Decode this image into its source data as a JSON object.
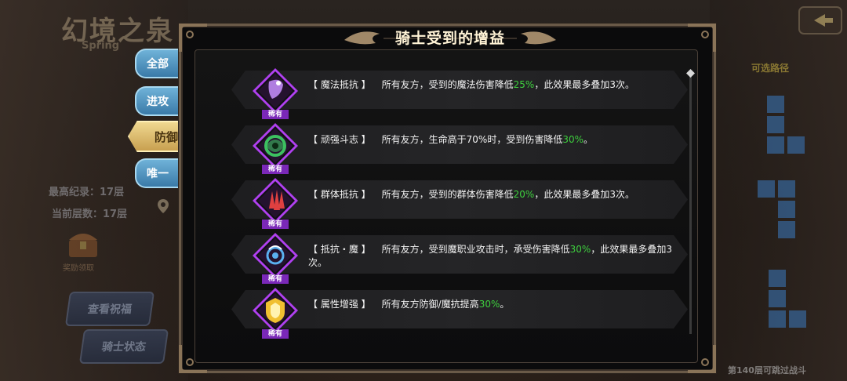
{
  "background": {
    "game_title": "幻境之泉",
    "game_title_sub": "Spring",
    "best_record": "最高纪录：17层",
    "current_floor": "当前层数：17层",
    "reward_label": "奖励领取",
    "view_buff_button": "查看祝福",
    "knight_status_button": "骑士状态",
    "route_title": "可选路径",
    "bottom_hint": "第140层可跳过战斗"
  },
  "side_tabs": {
    "all": "全部",
    "attack": "进攻",
    "defense": "防御",
    "unique": "唯一"
  },
  "panel": {
    "title": "骑士受到的增益",
    "buffs": [
      {
        "name": "【 魔法抵抗 】",
        "desc_before": "所有友方，受到的魔法伤害降低",
        "highlight": "25%",
        "desc_after": "，此效果最多叠加3次。",
        "rarity": "稀有",
        "icon": "magic-resist-icon",
        "color": "#b07ee0"
      },
      {
        "name": "【 顽强斗志 】",
        "desc_before": "所有友方，生命高于70%时，受到伤害降低",
        "highlight": "30%",
        "desc_after": "。",
        "rarity": "稀有",
        "icon": "tenacity-icon",
        "color": "#3cc060"
      },
      {
        "name": "【 群体抵抗 】",
        "desc_before": "所有友方，受到的群体伤害降低",
        "highlight": "20%",
        "desc_after": "，此效果最多叠加3次。",
        "rarity": "稀有",
        "icon": "aoe-resist-icon",
        "color": "#e04040"
      },
      {
        "name": "【 抵抗・魔 】",
        "desc_before": "所有友方，受到魔职业攻击时，承受伤害降低",
        "highlight": "30%",
        "desc_after": "，此效果最多叠加3次。",
        "rarity": "稀有",
        "icon": "mage-resist-icon",
        "color": "#5ab0f0"
      },
      {
        "name": "【 属性增强 】",
        "desc_before": "所有友方防御/魔抗提高",
        "highlight": "30%",
        "desc_after": "。",
        "rarity": "稀有",
        "icon": "stat-boost-icon",
        "color": "#f0c030"
      }
    ]
  },
  "colors": {
    "highlight_green": "#3ecf3e",
    "rarity_purple": "#7a28b8",
    "tab_blue": "#4a90c0",
    "tab_gold": "#e0c070"
  }
}
